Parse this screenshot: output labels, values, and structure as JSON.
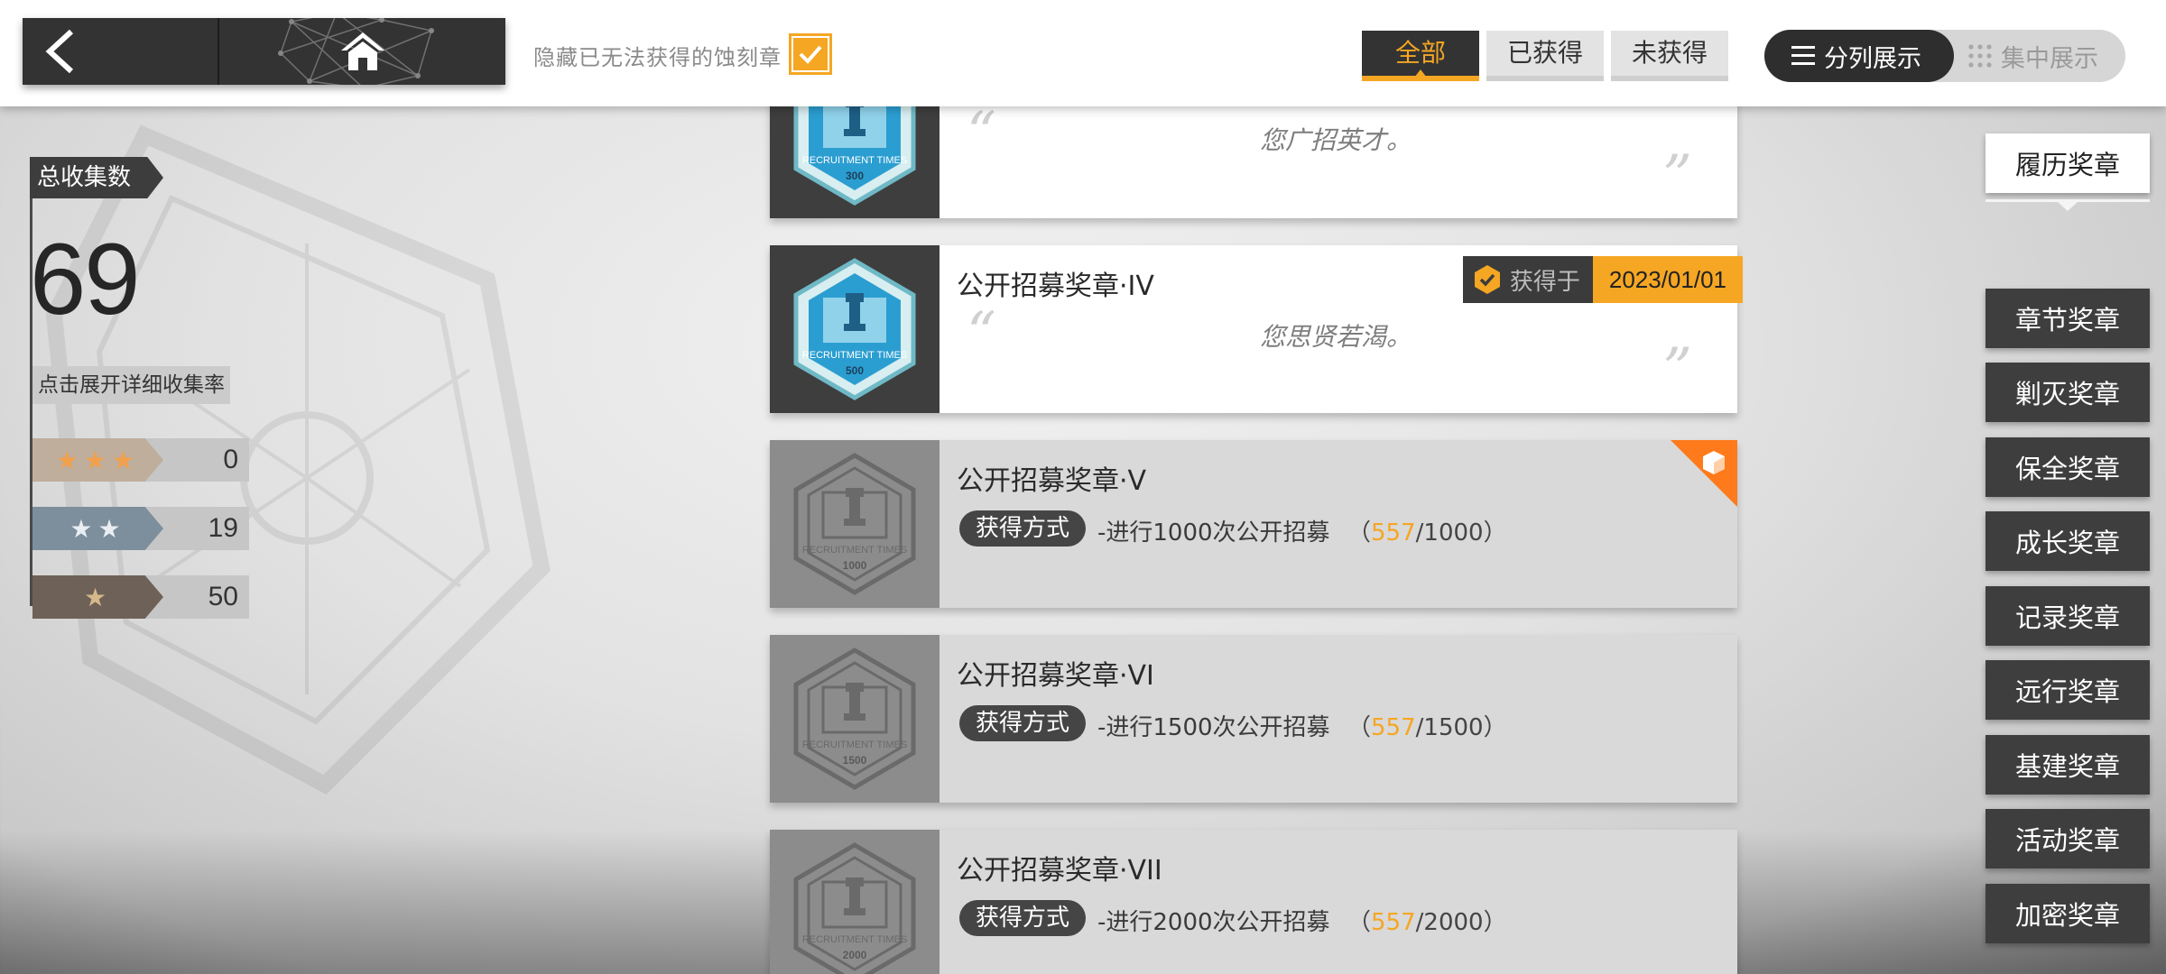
{
  "topbar": {
    "hide_unobtainable_label": "隐藏已无法获得的蚀刻章",
    "hide_unobtainable_checked": true,
    "filters": [
      {
        "label": "全部",
        "active": true
      },
      {
        "label": "已获得",
        "active": false
      },
      {
        "label": "未获得",
        "active": false
      }
    ],
    "view_modes": [
      {
        "label": "分列展示",
        "icon": "list-icon",
        "active": true
      },
      {
        "label": "集中展示",
        "icon": "grid-icon",
        "active": false
      }
    ]
  },
  "stats": {
    "header": "总收集数",
    "total": "69",
    "expand_label": "点击展开详细收集率",
    "rarities": [
      {
        "stars": "★★★",
        "count": "0"
      },
      {
        "stars": "★★",
        "count": "19"
      },
      {
        "stars": "★",
        "count": "50"
      }
    ]
  },
  "medals": [
    {
      "badge_text": "RECRUITMENT TIMES",
      "badge_number": "300",
      "status": "obtained",
      "quote": "您广招英才。"
    },
    {
      "name": "公开招募奖章·IV",
      "badge_text": "RECRUITMENT TIMES",
      "badge_number": "500",
      "status": "obtained",
      "obtained_label": "获得于",
      "obtained_date": "2023/01/01",
      "quote": "您思贤若渴。"
    },
    {
      "name": "公开招募奖章·V",
      "badge_text": "RECRUITMENT TIMES",
      "badge_number": "1000",
      "status": "locked",
      "method_label": "获得方式",
      "method_text": "-进行1000次公开招募",
      "progress_current": "557",
      "progress_total": "/1000",
      "progress_open": "（",
      "progress_close": "）",
      "corner_badge": true
    },
    {
      "name": "公开招募奖章·VI",
      "badge_text": "RECRUITMENT TIMES",
      "badge_number": "1500",
      "status": "locked",
      "method_label": "获得方式",
      "method_text": "-进行1500次公开招募",
      "progress_current": "557",
      "progress_total": "/1500",
      "progress_open": "（",
      "progress_close": "）"
    },
    {
      "name": "公开招募奖章·VII",
      "badge_text": "RECRUITMENT TIMES",
      "badge_number": "2000",
      "status": "locked",
      "method_label": "获得方式",
      "method_text": "-进行2000次公开招募",
      "progress_current": "557",
      "progress_total": "/2000",
      "progress_open": "（",
      "progress_close": "）"
    }
  ],
  "right_nav": [
    {
      "label": "履历奖章",
      "active": true
    },
    {
      "label": "章节奖章",
      "active": false
    },
    {
      "label": "剿灭奖章",
      "active": false
    },
    {
      "label": "保全奖章",
      "active": false
    },
    {
      "label": "成长奖章",
      "active": false
    },
    {
      "label": "记录奖章",
      "active": false
    },
    {
      "label": "远行奖章",
      "active": false
    },
    {
      "label": "基建奖章",
      "active": false
    },
    {
      "label": "活动奖章",
      "active": false
    },
    {
      "label": "加密奖章",
      "active": false
    }
  ],
  "colors": {
    "accent": "#f5a623",
    "dark_panel": "#3e3e3e",
    "locked_card": "#d9d9d9"
  }
}
